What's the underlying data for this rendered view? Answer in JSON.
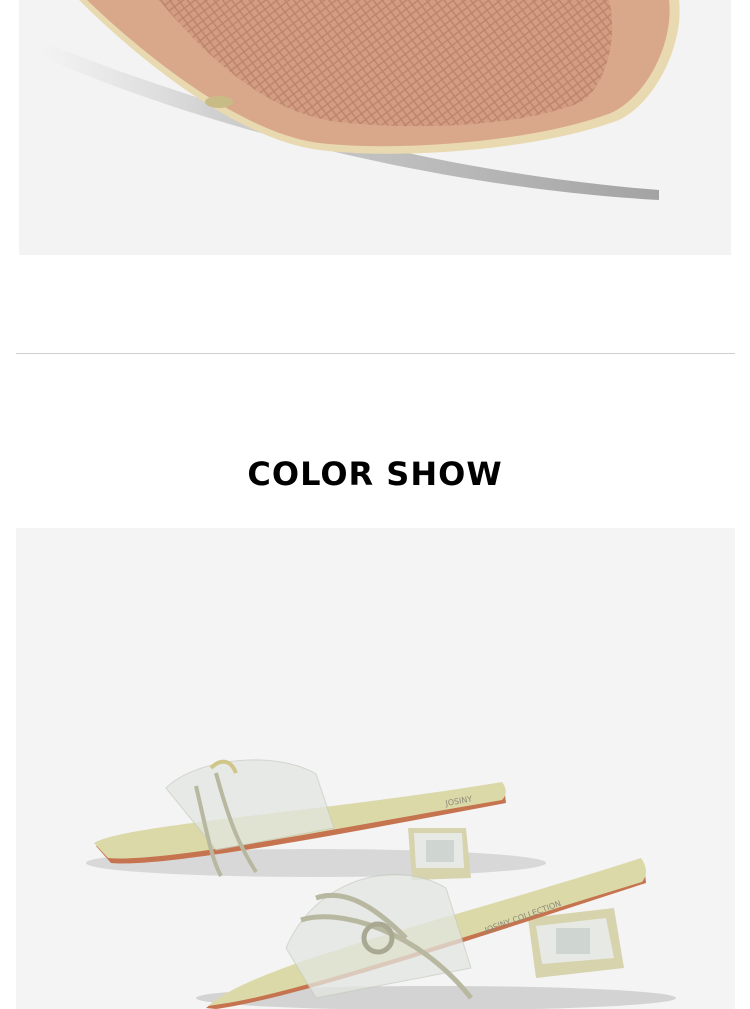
{
  "section": {
    "title": "COLOR SHOW"
  },
  "images": {
    "sole": {
      "subject": "sandal-sole-closeup"
    },
    "product": {
      "subject": "clear-strap-rhinestone-sandals",
      "brand_print": "JOSINY COLLECTION"
    }
  },
  "colors": {
    "background": "#ffffff",
    "photo_background": "#f4f4f4",
    "sole_tan": "#d9a78a",
    "footbed_cream": "#dcd9a8",
    "divider": "#cfcfcf"
  }
}
